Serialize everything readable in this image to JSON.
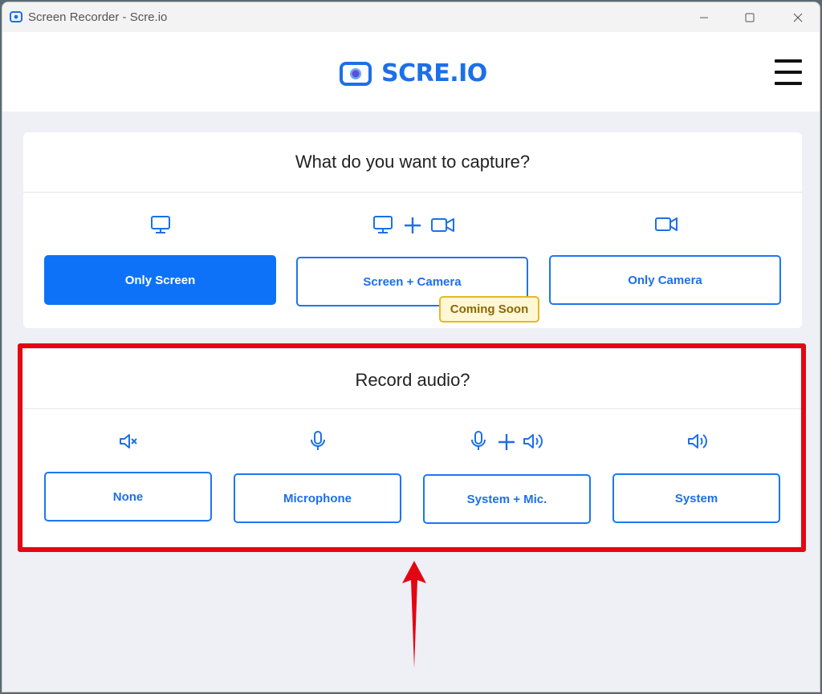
{
  "window": {
    "title": "Screen Recorder - Scre.io"
  },
  "header": {
    "logo_text": "SCRE.IO"
  },
  "capture": {
    "title": "What do you want to capture?",
    "options": [
      {
        "label": "Only Screen",
        "icon": "monitor-icon",
        "selected": true
      },
      {
        "label": "Screen + Camera",
        "icon": "monitor-plus-camera-icon",
        "selected": false,
        "badge": "Coming Soon"
      },
      {
        "label": "Only Camera",
        "icon": "video-camera-icon",
        "selected": false
      }
    ]
  },
  "audio": {
    "title": "Record audio?",
    "options": [
      {
        "label": "None",
        "icon": "muted-speaker-icon"
      },
      {
        "label": "Microphone",
        "icon": "microphone-icon"
      },
      {
        "label": "System + Mic.",
        "icon": "microphone-plus-speaker-icon"
      },
      {
        "label": "System",
        "icon": "speaker-icon"
      }
    ]
  },
  "colors": {
    "accent": "#0d72f7",
    "annotation": "#e30613",
    "badge_border": "#e5b923"
  }
}
